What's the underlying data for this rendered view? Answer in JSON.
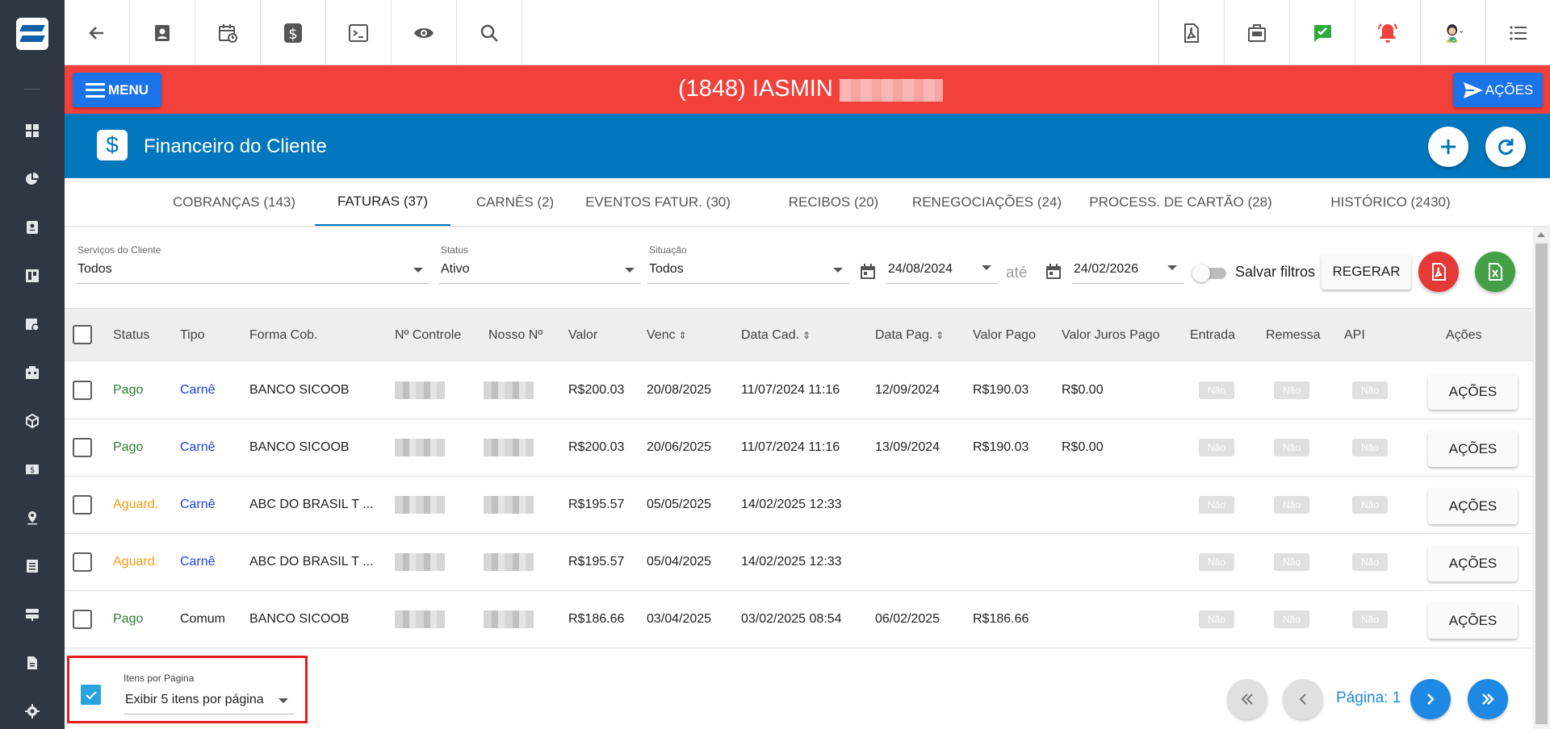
{
  "header": {
    "client_title": "(1848) IASMIN",
    "menu_label": "MENU",
    "acoes_label": "AÇÕES"
  },
  "section": {
    "title": "Financeiro do Cliente",
    "icon": "dollar-icon"
  },
  "tabs": [
    {
      "label": "COBRANÇAS (143)"
    },
    {
      "label": "FATURAS (37)",
      "active": true
    },
    {
      "label": "CARNÊS (2)"
    },
    {
      "label": "EVENTOS FATUR. (30)"
    },
    {
      "label": "RECIBOS (20)"
    },
    {
      "label": "RENEGOCIAÇÕES (24)"
    },
    {
      "label": "PROCESS. DE CARTÃO (28)"
    },
    {
      "label": "HISTÓRICO (2430)"
    }
  ],
  "filters": {
    "servicos": {
      "label": "Serviços do Cliente",
      "value": "Todos"
    },
    "status": {
      "label": "Status",
      "value": "Ativo"
    },
    "situacao": {
      "label": "Situação",
      "value": "Todos"
    },
    "date_from": "24/08/2024",
    "date_sep": "até",
    "date_to": "24/02/2026",
    "save_filters": "Salvar filtros",
    "regerar": "REGERAR"
  },
  "table": {
    "columns": [
      "Status",
      "Tipo",
      "Forma Cob.",
      "Nº Controle",
      "Nosso Nº",
      "Valor",
      "Venc",
      "Data Cad.",
      "Data Pag.",
      "Valor Pago",
      "Valor Juros Pago",
      "Entrada",
      "Remessa",
      "API",
      "Ações"
    ],
    "rows": [
      {
        "status": "Pago",
        "status_kind": "pago",
        "tipo": "Carnê",
        "forma": "BANCO SICOOB",
        "valor": "R$200.03",
        "venc": "20/08/2025",
        "cad": "11/07/2024 11:16",
        "pag": "12/09/2024",
        "valor_pago": "R$190.03",
        "juros": "R$0.00",
        "entrada": "Não",
        "remessa": "Não",
        "api": "Não",
        "acoes": "AÇÕES"
      },
      {
        "status": "Pago",
        "status_kind": "pago",
        "tipo": "Carnê",
        "forma": "BANCO SICOOB",
        "valor": "R$200.03",
        "venc": "20/06/2025",
        "cad": "11/07/2024 11:16",
        "pag": "13/09/2024",
        "valor_pago": "R$190.03",
        "juros": "R$0.00",
        "entrada": "Não",
        "remessa": "Não",
        "api": "Não",
        "acoes": "AÇÕES"
      },
      {
        "status": "Aguard.",
        "status_kind": "aguard",
        "tipo": "Carnê",
        "forma": "ABC DO BRASIL T ...",
        "valor": "R$195.57",
        "venc": "05/05/2025",
        "cad": "14/02/2025 12:33",
        "pag": "",
        "valor_pago": "",
        "juros": "",
        "entrada": "Não",
        "remessa": "Não",
        "api": "Não",
        "acoes": "AÇÕES"
      },
      {
        "status": "Aguard.",
        "status_kind": "aguard",
        "tipo": "Carnê",
        "forma": "ABC DO BRASIL T ...",
        "valor": "R$195.57",
        "venc": "05/04/2025",
        "cad": "14/02/2025 12:33",
        "pag": "",
        "valor_pago": "",
        "juros": "",
        "entrada": "Não",
        "remessa": "Não",
        "api": "Não",
        "acoes": "AÇÕES"
      },
      {
        "status": "Pago",
        "status_kind": "pago",
        "tipo": "Comum",
        "forma": "BANCO SICOOB",
        "valor": "R$186.66",
        "venc": "03/04/2025",
        "cad": "03/02/2025 08:54",
        "pag": "06/02/2025",
        "valor_pago": "R$186.66",
        "juros": "",
        "entrada": "Não",
        "remessa": "Não",
        "api": "Não",
        "acoes": "AÇÕES"
      }
    ]
  },
  "pagination": {
    "per_page_label": "Itens por Página",
    "per_page_value": "Exibir 5 itens por página",
    "page_label": "Página: 1"
  },
  "colors": {
    "red_bar": "#f2403a",
    "blue_header": "#0277bd",
    "accent": "#1a73e8",
    "pago": "#2e7d32",
    "aguard": "#f39c12",
    "carne": "#1a3fd8"
  }
}
